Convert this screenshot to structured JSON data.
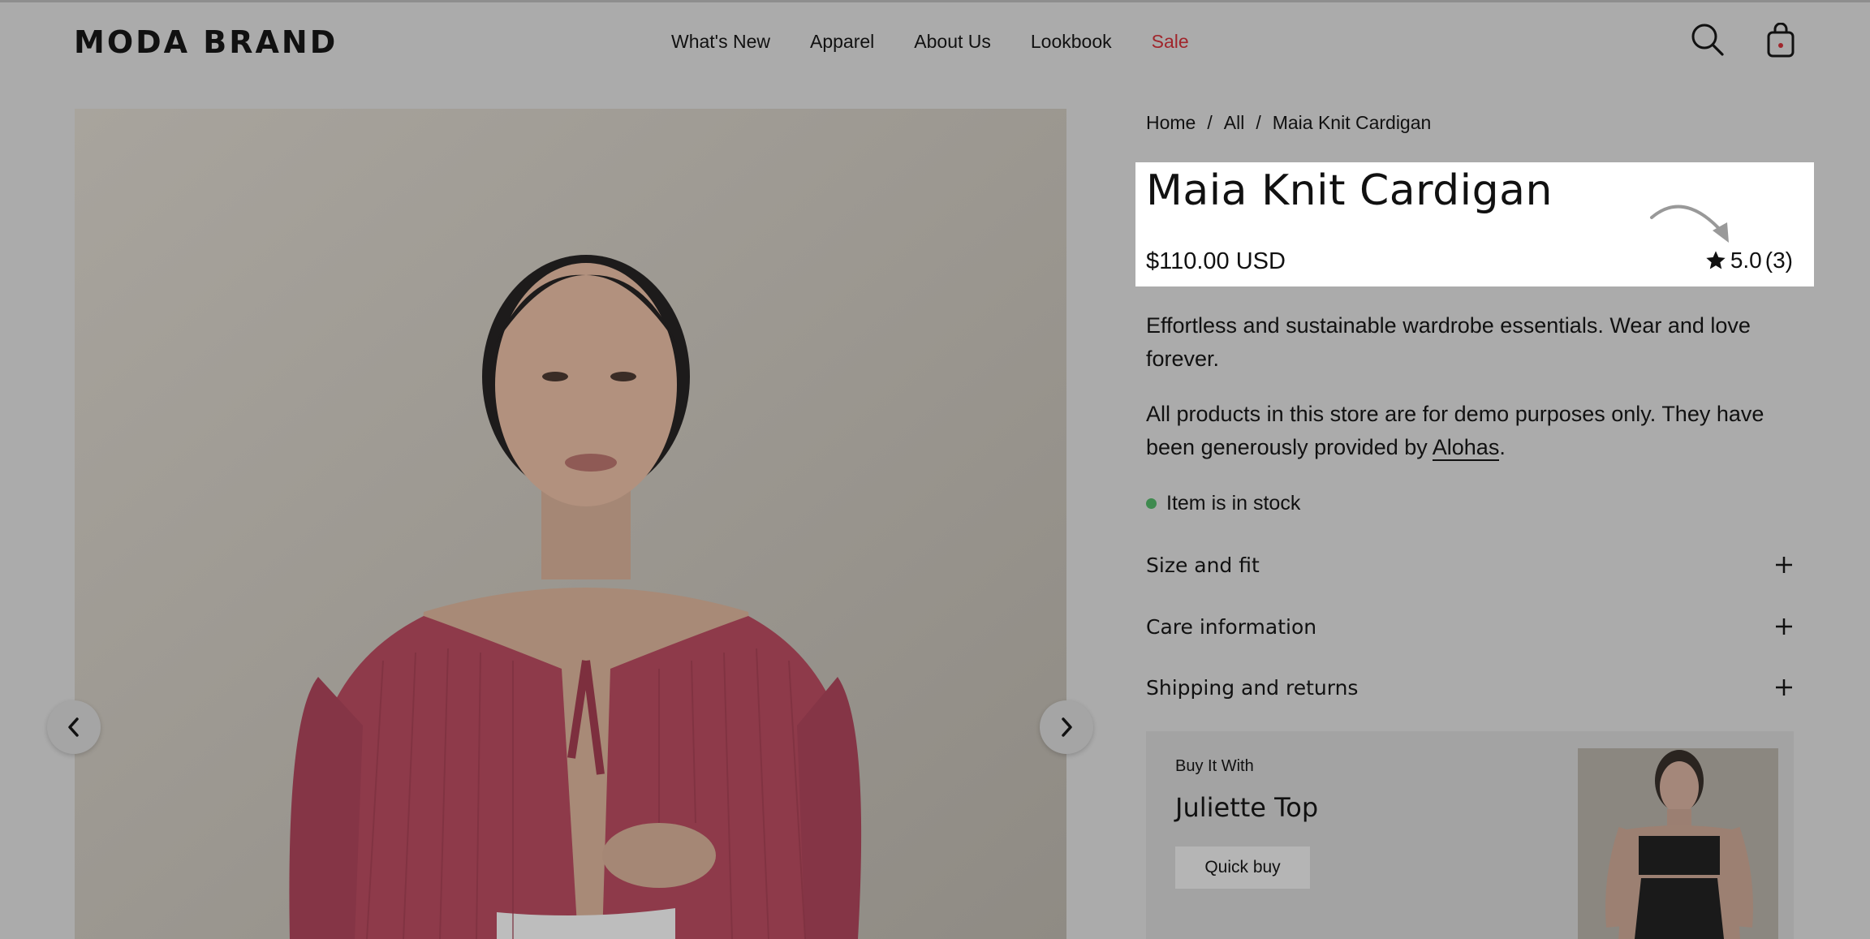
{
  "header": {
    "logo": "MODA BRAND",
    "nav": [
      "What's New",
      "Apparel",
      "About Us",
      "Lookbook",
      "Sale"
    ],
    "icons": [
      "search-icon",
      "shopping-bag-icon"
    ],
    "sale_color": "#a0262c"
  },
  "gallery": {
    "prev_icon": "chevron-left-icon",
    "next_icon": "chevron-right-icon"
  },
  "breadcrumb": {
    "items": [
      "Home",
      "All",
      "Maia Knit Cardigan"
    ],
    "separator": "/"
  },
  "product": {
    "title": "Maia Knit Cardigan",
    "price": "$110.00 USD",
    "rating": "5.0",
    "review_count": "(3)",
    "description_1": "Effortless and sustainable wardrobe essentials. Wear and love forever.",
    "description_2_prefix": "All products in this store are for demo purposes only. They have been generously provided by ",
    "description_2_link": "Alohas",
    "description_2_suffix": ".",
    "stock_status": "Item is in stock",
    "stock_color": "#3f8a4f"
  },
  "accordions": [
    {
      "label": "Size and fit"
    },
    {
      "label": "Care information"
    },
    {
      "label": "Shipping and returns"
    }
  ],
  "buy_it_with": {
    "eyebrow": "Buy It With",
    "title": "Juliette Top",
    "button": "Quick buy"
  }
}
